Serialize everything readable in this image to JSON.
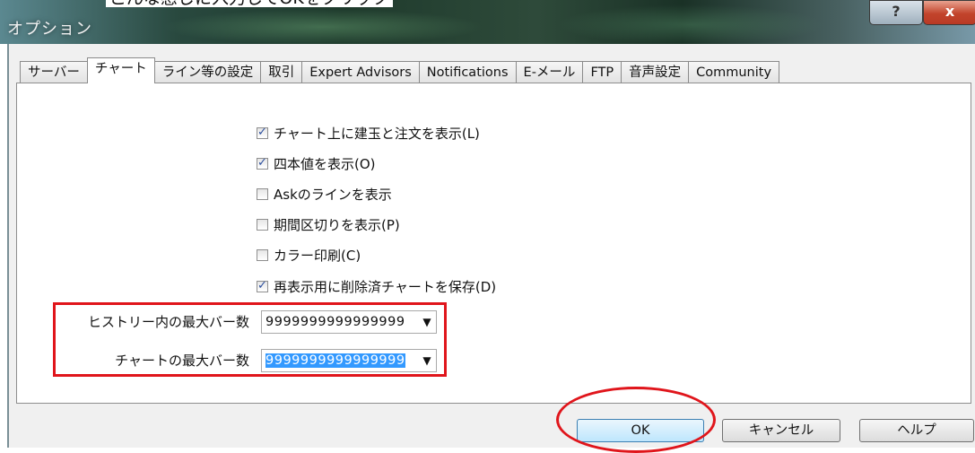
{
  "top_caption": "こんな感じに入力してOKをクリック",
  "window": {
    "title": "オプション",
    "help_glyph": "?",
    "close_glyph": "x"
  },
  "tabs": [
    {
      "label": "サーバー"
    },
    {
      "label": "チャート",
      "active": true
    },
    {
      "label": "ライン等の設定"
    },
    {
      "label": "取引"
    },
    {
      "label": "Expert Advisors"
    },
    {
      "label": "Notifications"
    },
    {
      "label": "E-メール"
    },
    {
      "label": "FTP"
    },
    {
      "label": "音声設定"
    },
    {
      "label": "Community"
    }
  ],
  "checkboxes": [
    {
      "label": "チャート上に建玉と注文を表示(L)",
      "checked": true
    },
    {
      "label": "四本値を表示(O)",
      "checked": true
    },
    {
      "label": "Askのラインを表示",
      "checked": false
    },
    {
      "label": "期間区切りを表示(P)",
      "checked": false
    },
    {
      "label": "カラー印刷(C)",
      "checked": false
    },
    {
      "label": "再表示用に削除済チャートを保存(D)",
      "checked": true
    }
  ],
  "fields": {
    "max_bars_history": {
      "label": "ヒストリー内の最大バー数",
      "value": "9999999999999999"
    },
    "max_bars_chart": {
      "label": "チャートの最大バー数",
      "value": "9999999999999999"
    }
  },
  "buttons": {
    "ok": "OK",
    "cancel": "キャンセル",
    "help": "ヘルプ"
  },
  "colors": {
    "annotation_red": "#e0151b",
    "selection_blue": "#3399ff",
    "close_red": "#c2442c"
  },
  "icons": {
    "dropdown": "chevron-down-icon",
    "checkmark": "check-icon"
  }
}
